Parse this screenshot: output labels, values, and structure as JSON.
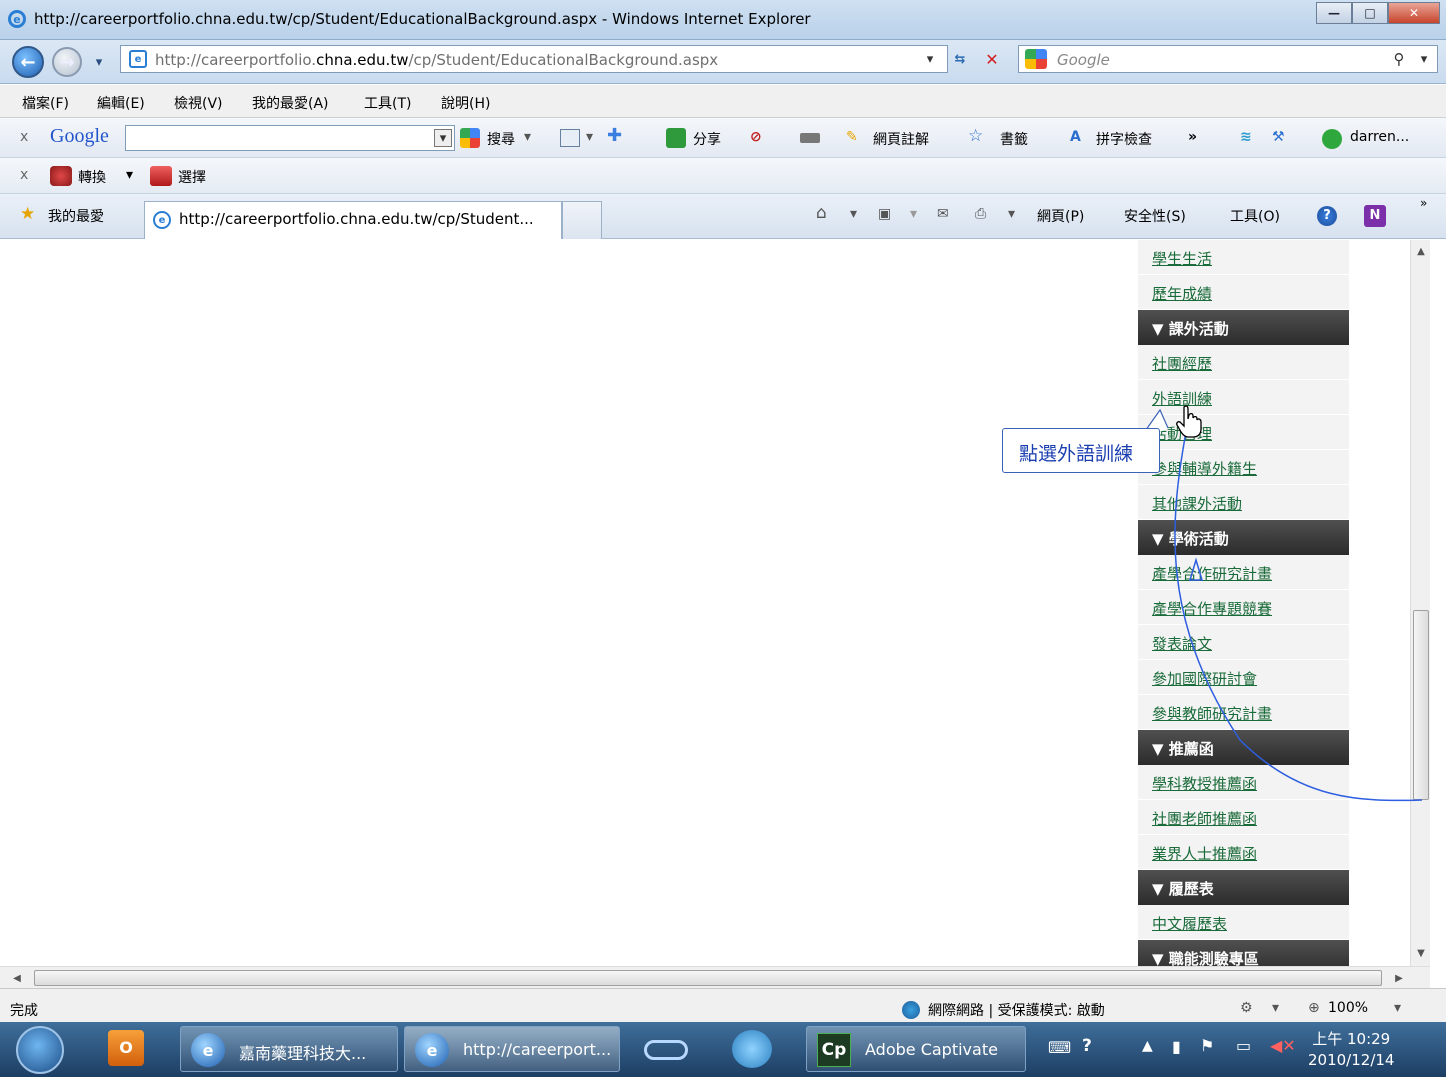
{
  "window": {
    "title": "http://careerportfolio.chna.edu.tw/cp/Student/EducationalBackground.aspx - Windows Internet Explorer",
    "min_glyph": "—",
    "max_glyph": "□",
    "close_glyph": "✕"
  },
  "address_bar": {
    "url_prefix": "http://careerportfolio.",
    "url_host": "chna.edu.tw",
    "url_suffix": "/cp/Student/EducationalBackground.aspx",
    "search_placeholder": "Google"
  },
  "menu": [
    "檔案(F)",
    "編輯(E)",
    "檢視(V)",
    "我的最愛(A)",
    "工具(T)",
    "說明(H)"
  ],
  "google_toolbar": {
    "close": "x",
    "logo": "Google",
    "search_label": "搜尋",
    "share": "分享",
    "annotate": "網頁註解",
    "bookmarks": "書籤",
    "spellcheck": "拼字檢查",
    "more": "»",
    "user": "darren..."
  },
  "convert_toolbar": {
    "close": "x",
    "convert": "轉換",
    "select": "選擇"
  },
  "favorites_bar": {
    "favorites": "我的最愛",
    "tab_title": "http://careerportfolio.chna.edu.tw/cp/Student...",
    "page_menu": "網頁(P)",
    "safety_menu": "安全性(S)",
    "tools_menu": "工具(O)",
    "more": "»"
  },
  "sidebar": [
    {
      "type": "link",
      "label": "學生生活"
    },
    {
      "type": "link",
      "label": "歷年成績"
    },
    {
      "type": "head",
      "label": "▼ 課外活動"
    },
    {
      "type": "link",
      "label": "社團經歷"
    },
    {
      "type": "link",
      "label": "外語訓練"
    },
    {
      "type": "link",
      "label": "活動管理"
    },
    {
      "type": "link",
      "label": "參與輔導外籍生"
    },
    {
      "type": "link",
      "label": "其他課外活動"
    },
    {
      "type": "head",
      "label": "▼ 學術活動"
    },
    {
      "type": "link",
      "label": "產學合作研究計畫"
    },
    {
      "type": "link",
      "label": "產學合作專題競賽"
    },
    {
      "type": "link",
      "label": "發表論文"
    },
    {
      "type": "link",
      "label": "參加國際研討會"
    },
    {
      "type": "link",
      "label": "參與教師研究計畫"
    },
    {
      "type": "head",
      "label": "▼ 推薦函"
    },
    {
      "type": "link",
      "label": "學科教授推薦函"
    },
    {
      "type": "link",
      "label": "社團老師推薦函"
    },
    {
      "type": "link",
      "label": "業界人士推薦函"
    },
    {
      "type": "head",
      "label": "▼ 履歷表"
    },
    {
      "type": "link",
      "label": "中文履歷表"
    },
    {
      "type": "head",
      "label": "▼ 職能測驗專區"
    }
  ],
  "callout": {
    "text": "點選外語訓練"
  },
  "status_bar": {
    "left": "完成",
    "zone": "網際網路 | 受保護模式: 啟動",
    "zoom": "100%"
  },
  "taskbar": {
    "items": [
      "嘉南藥理科技大...",
      "http://careerport...",
      "Adobe Captivate"
    ],
    "captivate_badge": "Cp",
    "time": "上午 10:29",
    "date": "2010/12/14"
  },
  "colors": {
    "link": "#1a6b3a",
    "section_header": "#333333",
    "callout_text": "#1b3fb0",
    "annotation_line": "#2e5fe0"
  }
}
